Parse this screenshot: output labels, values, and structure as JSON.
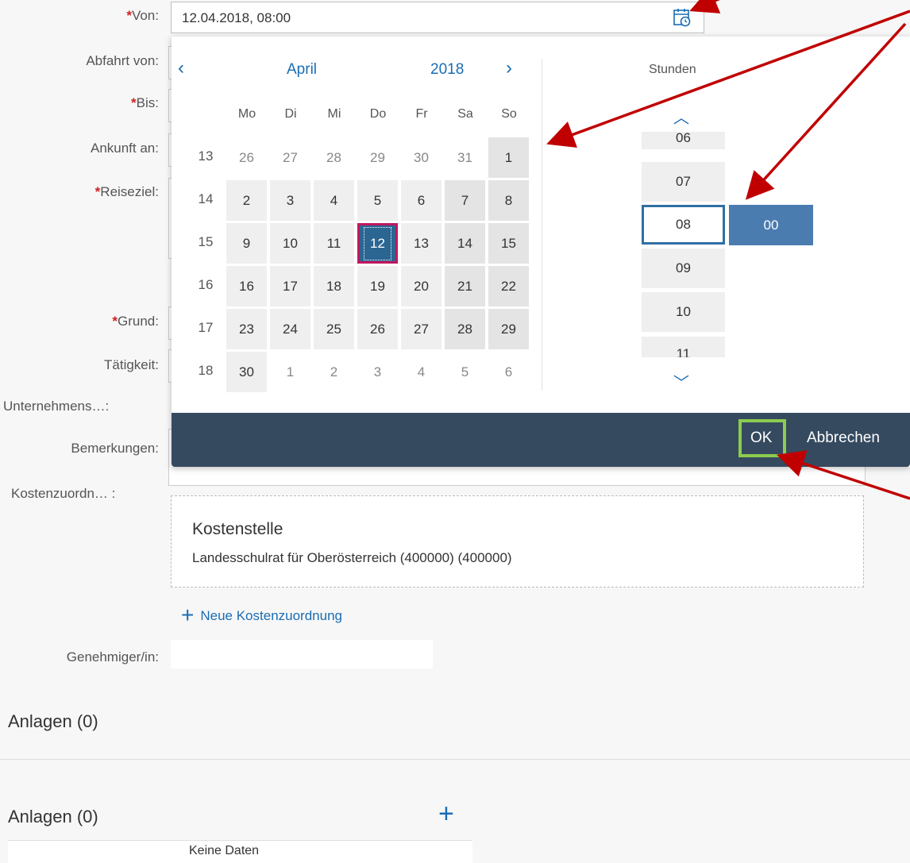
{
  "form": {
    "von_label": "Von:",
    "von_value": "12.04.2018, 08:00",
    "abfahrt_label": "Abfahrt von:",
    "bis_label": "Bis:",
    "ankunft_label": "Ankunft an:",
    "reiseziel_label": "Reiseziel:",
    "grund_label": "Grund:",
    "taetigkeit_label": "Tätigkeit:",
    "unternehmens_label": "Unternehmens…:",
    "bemerkungen_label": "Bemerkungen:",
    "kosten_label": "Kostenzuordn… :",
    "genehmiger_label": "Genehmiger/in:",
    "required_marker": "*"
  },
  "datepicker": {
    "month": "April",
    "year": "2018",
    "prev": "‹",
    "next": "›",
    "weekdays": [
      "Mo",
      "Di",
      "Mi",
      "Do",
      "Fr",
      "Sa",
      "So"
    ],
    "weeks": [
      "13",
      "14",
      "15",
      "16",
      "17",
      "18"
    ],
    "days": [
      [
        "26",
        "27",
        "28",
        "29",
        "30",
        "31",
        "1"
      ],
      [
        "2",
        "3",
        "4",
        "5",
        "6",
        "7",
        "8"
      ],
      [
        "9",
        "10",
        "11",
        "12",
        "13",
        "14",
        "15"
      ],
      [
        "16",
        "17",
        "18",
        "19",
        "20",
        "21",
        "22"
      ],
      [
        "23",
        "24",
        "25",
        "26",
        "27",
        "28",
        "29"
      ],
      [
        "30",
        "1",
        "2",
        "3",
        "4",
        "5",
        "6"
      ]
    ],
    "selected_day": "12"
  },
  "timepicker": {
    "hours_label": "Stunden",
    "hours": [
      "06",
      "07",
      "08",
      "09",
      "10",
      "11"
    ],
    "selected_hour": "08",
    "minute": "00",
    "up": "︿",
    "down": "﹀"
  },
  "footer": {
    "ok": "OK",
    "cancel": "Abbrechen"
  },
  "kosten": {
    "title": "Kostenstelle",
    "value": "Landesschulrat für Oberösterreich (400000) (400000)",
    "add_link": "Neue Kostenzuordnung",
    "add_icon": "+"
  },
  "anlagen": {
    "section_title": "Anlagen (0)",
    "table_title": "Anlagen (0)",
    "add_icon": "+",
    "no_data": "Keine Daten"
  },
  "colors": {
    "accent": "#1a6db4",
    "selected_day": "#2b6592",
    "footer": "#354a5f",
    "ok_highlight": "#8ccc4e",
    "annotation_arrow": "#c00000"
  }
}
